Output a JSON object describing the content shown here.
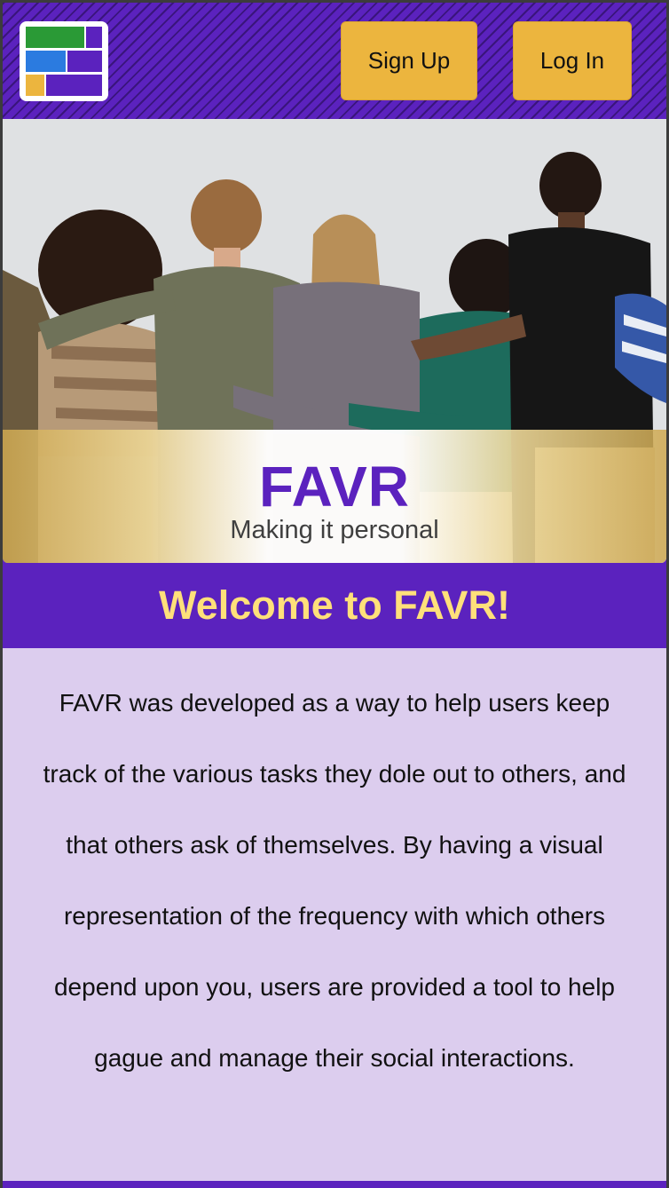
{
  "header": {
    "logo_icon": "favr-logo-icon",
    "sign_up_label": "Sign Up",
    "log_in_label": "Log In"
  },
  "hero": {
    "image": "group-of-friends-arms-around-each-other-photo",
    "brand": "FAVR",
    "tagline": "Making it personal"
  },
  "welcome": {
    "heading": "Welcome to FAVR!"
  },
  "description": {
    "text": "FAVR was developed as a way to help users keep track of the various tasks they dole out to others, and that others ask of themselves. By having a visual representation of the frequency with which others depend upon you, users are provided a tool to help gague and manage their social interactions."
  },
  "colors": {
    "primary_purple": "#5b22be",
    "accent_gold": "#ecb53e",
    "heading_yellow": "#ffe07a",
    "panel_lavender": "#dccdee"
  }
}
